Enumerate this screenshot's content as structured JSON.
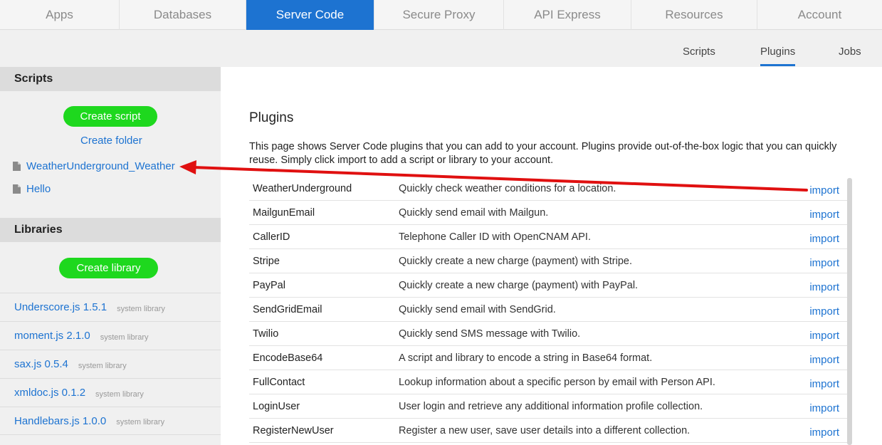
{
  "topnav": {
    "tabs": [
      {
        "label": "Apps",
        "active": false
      },
      {
        "label": "Databases",
        "active": false
      },
      {
        "label": "Server Code",
        "active": true
      },
      {
        "label": "Secure Proxy",
        "active": false
      },
      {
        "label": "API Express",
        "active": false
      },
      {
        "label": "Resources",
        "active": false
      },
      {
        "label": "Account",
        "active": false
      }
    ]
  },
  "subnav": {
    "tabs": [
      {
        "label": "Scripts",
        "active": false
      },
      {
        "label": "Plugins",
        "active": true
      },
      {
        "label": "Jobs",
        "active": false
      }
    ]
  },
  "sidebar": {
    "scripts_heading": "Scripts",
    "create_script": "Create script",
    "create_folder": "Create folder",
    "scripts": [
      "WeatherUnderground_Weather",
      "Hello"
    ],
    "libraries_heading": "Libraries",
    "create_library": "Create library",
    "libraries": [
      {
        "name": "Underscore.js 1.5.1",
        "tag": "system library"
      },
      {
        "name": "moment.js 2.1.0",
        "tag": "system library"
      },
      {
        "name": "sax.js 0.5.4",
        "tag": "system library"
      },
      {
        "name": "xmldoc.js 0.1.2",
        "tag": "system library"
      },
      {
        "name": "Handlebars.js 1.0.0",
        "tag": "system library"
      }
    ]
  },
  "main": {
    "title": "Plugins",
    "description": "This page shows Server Code plugins that you can add to your account. Plugins provide out-of-the-box logic that you can quickly reuse. Simply click import to add a script or library to your account.",
    "import_label": "import",
    "plugins": [
      {
        "name": "WeatherUnderground",
        "desc": "Quickly check weather conditions for a location."
      },
      {
        "name": "MailgunEmail",
        "desc": "Quickly send email with Mailgun."
      },
      {
        "name": "CallerID",
        "desc": "Telephone Caller ID with OpenCNAM API."
      },
      {
        "name": "Stripe",
        "desc": "Quickly create a new charge (payment) with Stripe."
      },
      {
        "name": "PayPal",
        "desc": "Quickly create a new charge (payment) with PayPal."
      },
      {
        "name": "SendGridEmail",
        "desc": "Quickly send email with SendGrid."
      },
      {
        "name": "Twilio",
        "desc": "Quickly send SMS message with Twilio."
      },
      {
        "name": "EncodeBase64",
        "desc": "A script and library to encode a string in Base64 format."
      },
      {
        "name": "FullContact",
        "desc": "Lookup information about a specific person by email with Person API."
      },
      {
        "name": "LoginUser",
        "desc": "User login and retrieve any additional information profile collection."
      },
      {
        "name": "RegisterNewUser",
        "desc": "Register a new user, save user details into a different collection."
      }
    ]
  },
  "colors": {
    "accent": "#1d73d1",
    "green": "#1ed81e",
    "annotation": "#e01010"
  }
}
